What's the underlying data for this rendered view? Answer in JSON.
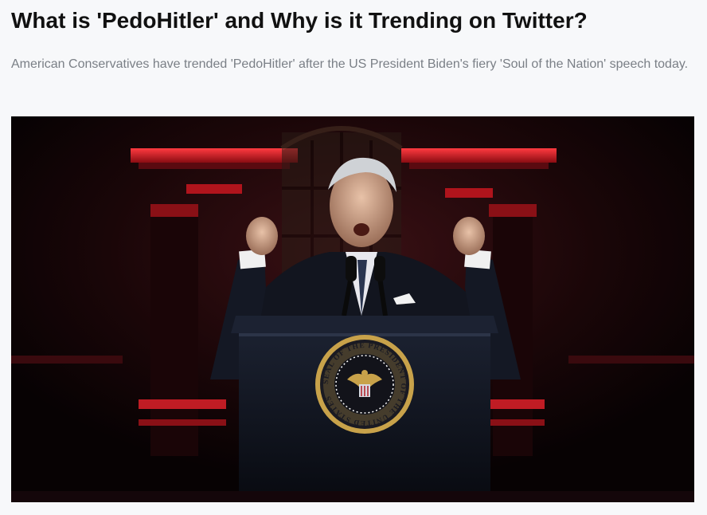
{
  "article": {
    "title": "What is 'PedoHitler' and Why is it Trending on Twitter?",
    "summary": "American Conservatives have trended 'PedoHitler' after the US President Biden's fiery 'Soul of the Nation' speech today."
  },
  "hero_image": {
    "seal_text": "SEAL OF THE PRESIDENT OF THE UNITED STATES",
    "colors": {
      "backdrop": "#0b0406",
      "red_light": "#d0202a",
      "podium": "#10141f",
      "seal_gold": "#c8a24a"
    }
  }
}
